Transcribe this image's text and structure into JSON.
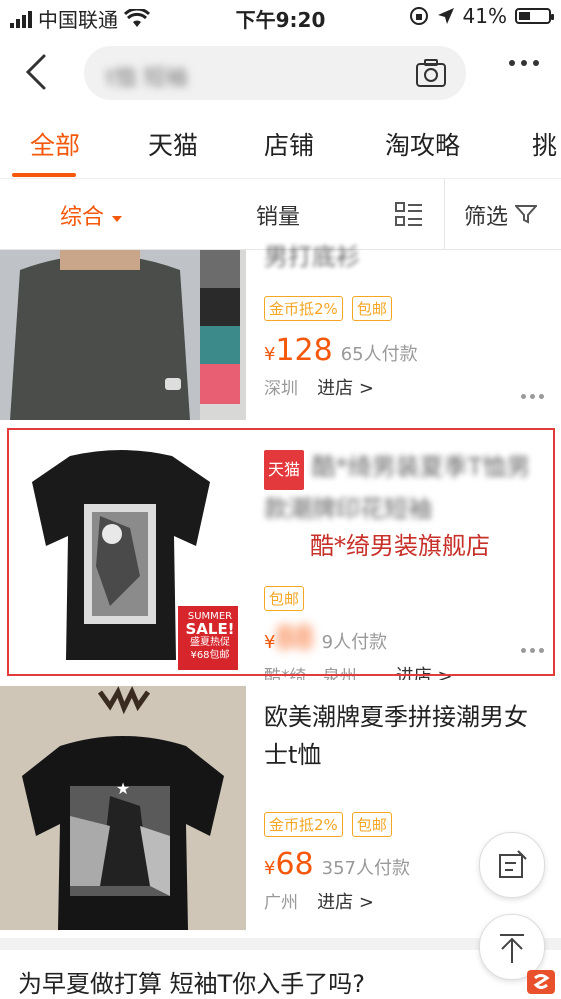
{
  "status_bar": {
    "carrier": "中国联通",
    "time": "下午9:20",
    "battery": "41%",
    "battery_fraction": 0.41
  },
  "search": {
    "query": "t恤 短袖"
  },
  "tabs": [
    {
      "label": "全部"
    },
    {
      "label": "天猫"
    },
    {
      "label": "店铺"
    },
    {
      "label": "淘攻略"
    },
    {
      "label": "挑"
    }
  ],
  "sort": {
    "comprehensive": "综合",
    "sales": "销量",
    "filter": "筛选"
  },
  "products": [
    {
      "title_fragment": "男打底衫",
      "tags": [
        "金币抵2%",
        "包邮"
      ],
      "currency": "¥",
      "price": "128",
      "sold": "65人付款",
      "location": "深圳",
      "enter_store": "进店 >"
    },
    {
      "badge": "天猫",
      "title": "酷*绮男装夏季T恤男款潮牌印花短袖",
      "tags": [
        "包邮"
      ],
      "currency": "¥",
      "price": "88",
      "sold": "9人付款",
      "shop": "酷*绮...泉州",
      "enter_store": "进店 >",
      "promo_line1": "SUMMER",
      "promo_line2": "SALE!",
      "promo_line3": "盛夏热促",
      "promo_line4": "¥68包邮",
      "annotation": "酷*绮男装旗舰店"
    },
    {
      "title": "欧美潮牌夏季拼接潮男女士t恤",
      "tags": [
        "金币抵2%",
        "包邮"
      ],
      "currency": "¥",
      "price": "68",
      "sold": "357人付款",
      "location": "广州",
      "enter_store": "进店 >"
    }
  ],
  "bottom_banner": "为早夏做打算 短袖T你入手了吗?"
}
